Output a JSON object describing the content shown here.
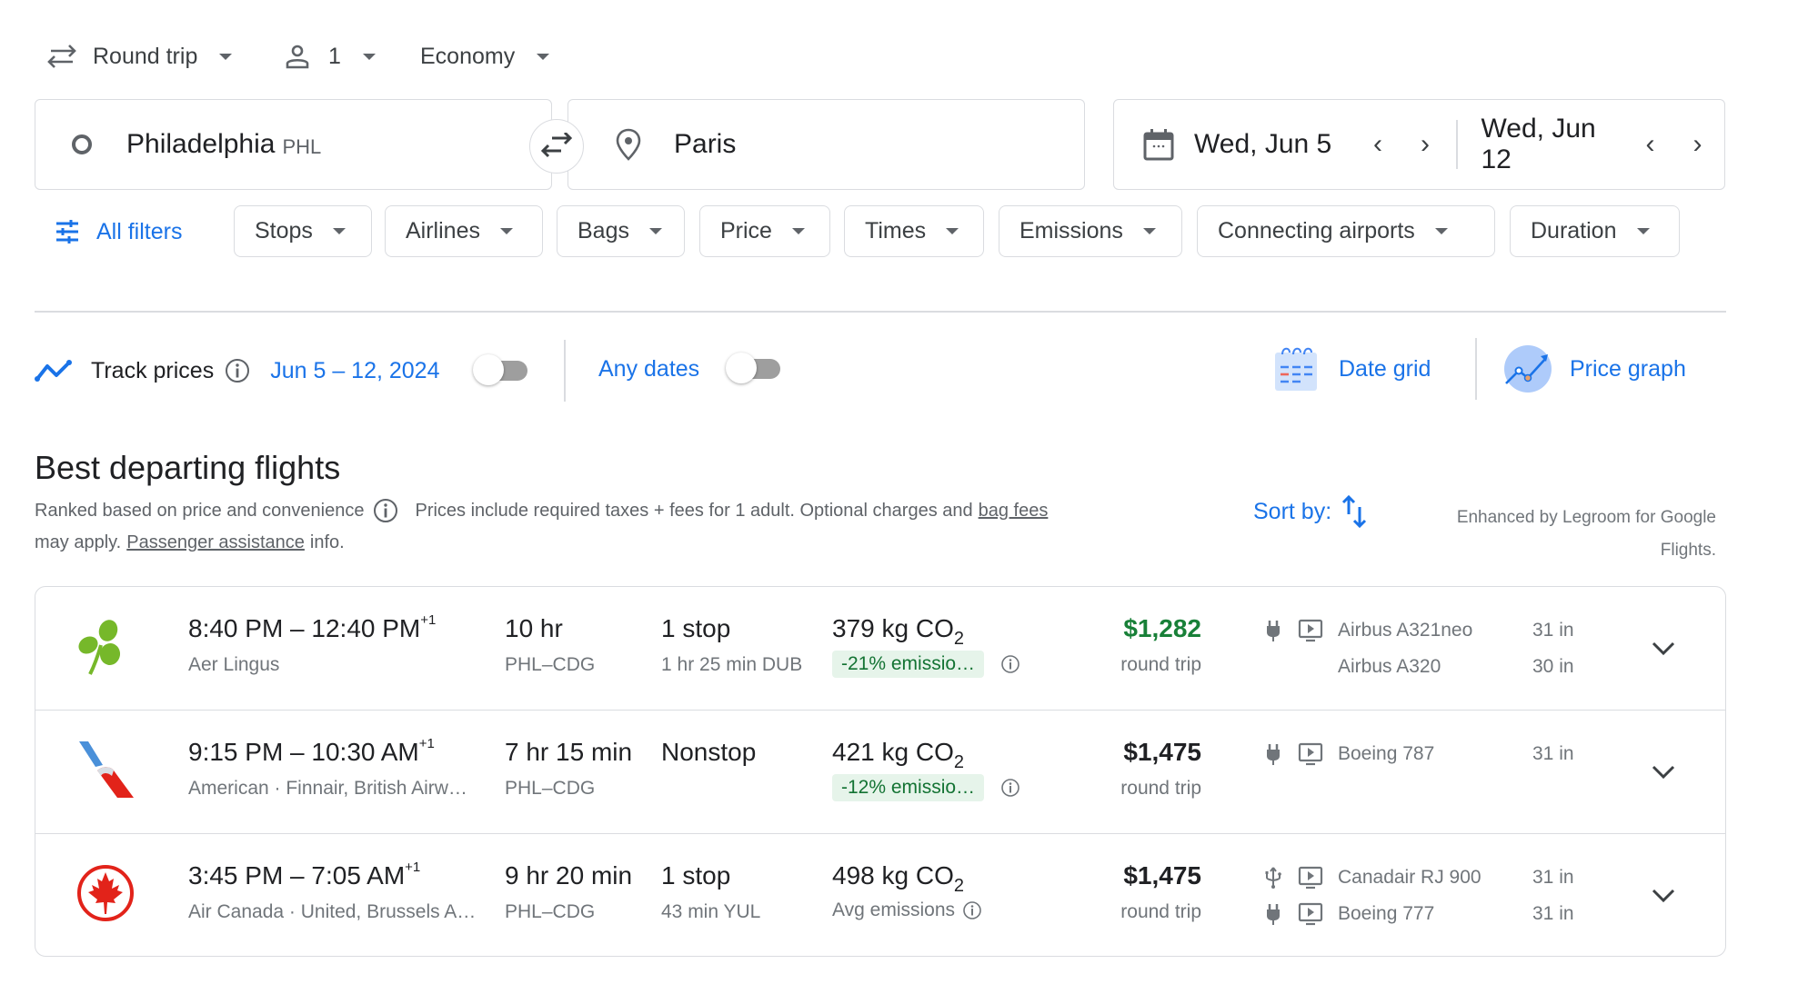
{
  "top": {
    "trip_type": "Round trip",
    "passengers": "1",
    "cabin_class": "Economy"
  },
  "search": {
    "origin_city": "Philadelphia",
    "origin_code": "PHL",
    "destination": "Paris",
    "depart_date": "Wed, Jun 5",
    "return_date": "Wed, Jun 12"
  },
  "filters": {
    "all_filters": "All filters",
    "chips": [
      "Stops",
      "Airlines",
      "Bags",
      "Price",
      "Times",
      "Emissions",
      "Connecting airports",
      "Duration"
    ]
  },
  "track": {
    "label": "Track prices",
    "date_range": "Jun 5 – 12, 2024",
    "track_toggle_on": false,
    "any_dates": "Any dates",
    "any_dates_toggle_on": false,
    "date_grid": "Date grid",
    "price_graph": "Price graph"
  },
  "results": {
    "heading": "Best departing flights",
    "ranked": "Ranked based on price and convenience",
    "prices_note": "Prices include required taxes + fees for 1 adult. Optional charges and",
    "bag_fees": "bag fees",
    "may_apply": "may apply.",
    "passenger_assistance": "Passenger assistance",
    "info": "info.",
    "sort_by": "Sort by:",
    "enhanced_line1": "Enhanced by Legroom for Google",
    "enhanced_line2": "Flights."
  },
  "flights": [
    {
      "airline_logo": "aer-lingus-shamrock",
      "times": "8:40 PM – 12:40 PM",
      "day_offset": "+1",
      "airlines": "Aer Lingus",
      "duration": "10 hr",
      "route": "PHL–CDG",
      "stops": "1 stop",
      "layover": "1 hr 25 min DUB",
      "co2_value": "379 kg CO",
      "co2_sub": "2",
      "emissions_label": "-21% emissio…",
      "emissions_badge": true,
      "price": "$1,282",
      "price_green": true,
      "price_type": "round trip",
      "aircraft": [
        {
          "power": "plug",
          "entertainment": "video-screen",
          "model": "Airbus A321neo",
          "legroom": "31 in"
        },
        {
          "power": "",
          "entertainment": "",
          "model": "Airbus A320",
          "legroom": "30 in"
        }
      ]
    },
    {
      "airline_logo": "american-airlines",
      "times": "9:15 PM – 10:30 AM",
      "day_offset": "+1",
      "airlines": "American · Finnair, British Airw…",
      "duration": "7 hr 15 min",
      "route": "PHL–CDG",
      "stops": "Nonstop",
      "layover": "",
      "co2_value": "421 kg CO",
      "co2_sub": "2",
      "emissions_label": "-12% emissio…",
      "emissions_badge": true,
      "price": "$1,475",
      "price_green": false,
      "price_type": "round trip",
      "aircraft": [
        {
          "power": "plug",
          "entertainment": "video-screen",
          "model": "Boeing 787",
          "legroom": "31 in"
        }
      ]
    },
    {
      "airline_logo": "air-canada-maple-leaf",
      "times": "3:45 PM – 7:05 AM",
      "day_offset": "+1",
      "airlines": "Air Canada · United, Brussels A…",
      "duration": "9 hr 20 min",
      "route": "PHL–CDG",
      "stops": "1 stop",
      "layover": "43 min YUL",
      "co2_value": "498 kg CO",
      "co2_sub": "2",
      "emissions_label": "Avg emissions",
      "emissions_badge": false,
      "price": "$1,475",
      "price_green": false,
      "price_type": "round trip",
      "aircraft": [
        {
          "power": "usb",
          "entertainment": "video-screen",
          "model": "Canadair RJ 900",
          "legroom": "31 in"
        },
        {
          "power": "plug",
          "entertainment": "video-screen",
          "model": "Boeing 777",
          "legroom": "31 in"
        }
      ]
    }
  ],
  "colors": {
    "accent_blue": "#1a73e8",
    "price_green": "#188038",
    "emissions_bg": "#e6f4ea",
    "emissions_text": "#137333"
  }
}
